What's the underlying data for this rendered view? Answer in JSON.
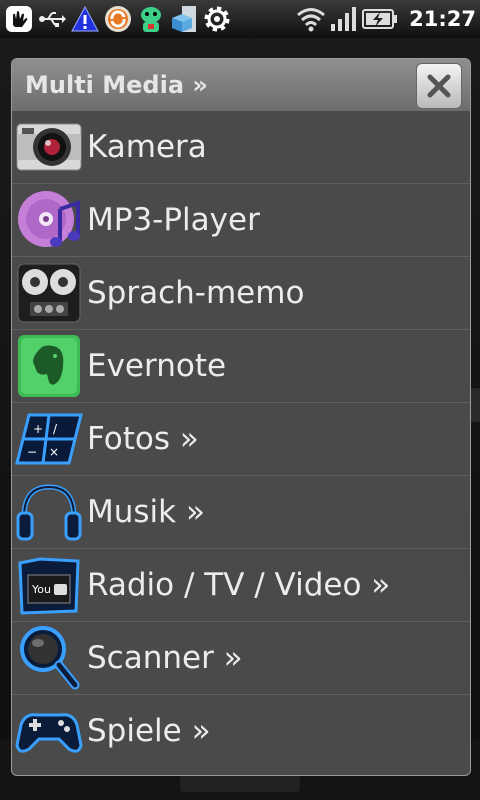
{
  "status_bar": {
    "time": "21:27",
    "icons": [
      "hand-notification-icon",
      "usb-icon",
      "warning-icon",
      "sync-app-icon",
      "android-robot-icon",
      "package-icon",
      "settings-gear-icon",
      "wifi-icon",
      "signal-icon",
      "battery-charging-icon"
    ]
  },
  "dialog": {
    "title": "Multi Media »",
    "close_icon": "close-x-icon",
    "items": [
      {
        "label": "Kamera",
        "icon": "camera-icon"
      },
      {
        "label": "MP3-Player",
        "icon": "music-disc-icon"
      },
      {
        "label": "Sprach-memo",
        "icon": "tape-recorder-icon"
      },
      {
        "label": "Evernote",
        "icon": "evernote-elephant-icon"
      },
      {
        "label": "Fotos »",
        "icon": "photo-grid-icon"
      },
      {
        "label": "Musik »",
        "icon": "headphones-icon"
      },
      {
        "label": "Radio / TV / Video »",
        "icon": "video-folder-icon"
      },
      {
        "label": "Scanner »",
        "icon": "magnifier-icon"
      },
      {
        "label": "Spiele »",
        "icon": "gamepad-icon"
      }
    ]
  }
}
